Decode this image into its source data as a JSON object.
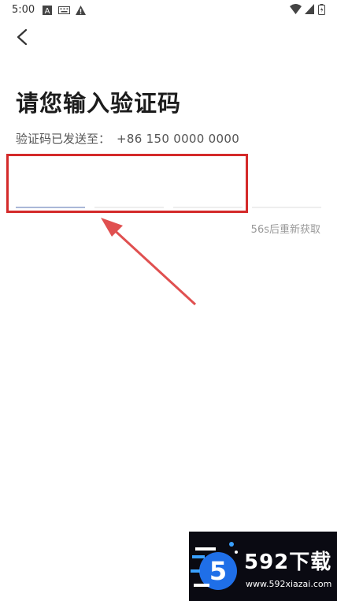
{
  "status_bar": {
    "time": "5:00",
    "icons": [
      "text-a-icon",
      "keyboard-icon",
      "warning-icon"
    ],
    "right_icons": [
      "wifi-icon",
      "signal-icon",
      "battery-icon"
    ]
  },
  "nav": {
    "back_icon": "chevron-left-icon"
  },
  "page": {
    "title": "请您输入验证码",
    "sent_label": "验证码已发送至：",
    "phone": "+86  150 0000 0000",
    "resend_text": "56s后重新获取"
  },
  "code_input": {
    "slot_count": 3,
    "active_slot": 0
  },
  "annotation": {
    "color": "#d42a2a"
  },
  "watermark": {
    "brand_text": "592下载",
    "url": "www.592xiazai.com",
    "logo_digit": "5",
    "logo_color": "#1f6fe8"
  }
}
